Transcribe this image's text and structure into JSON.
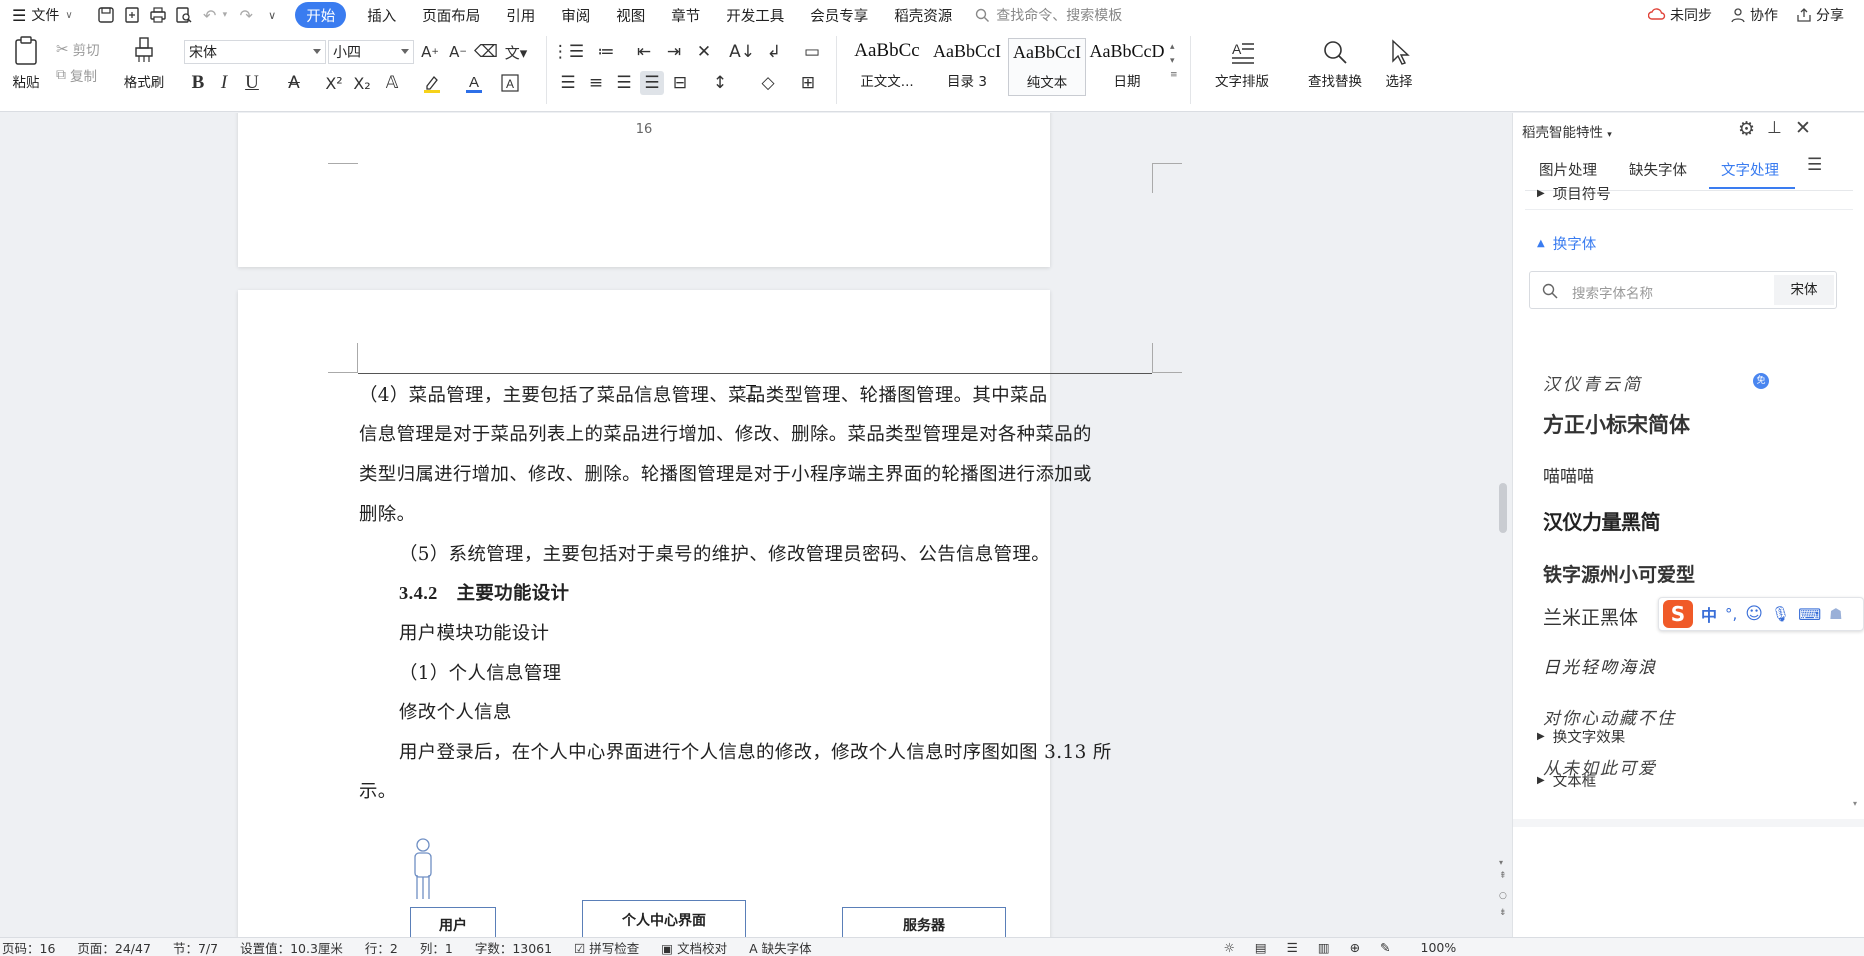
{
  "menubar": {
    "file_label": "文件",
    "tabs": [
      "开始",
      "插入",
      "页面布局",
      "引用",
      "审阅",
      "视图",
      "章节",
      "开发工具",
      "会员专享",
      "稻壳资源"
    ],
    "search_placeholder": "查找命令、搜索模板",
    "sync_label": "未同步",
    "collab_label": "协作",
    "share_label": "分享"
  },
  "ribbon": {
    "paste_label": "粘贴",
    "cut_label": "剪切",
    "copy_label": "复制",
    "format_painter_label": "格式刷",
    "font_name": "宋体",
    "font_size": "小四",
    "styles": [
      {
        "sample": "AaBbCc",
        "name": "正文文..."
      },
      {
        "sample": "AaBbCcI",
        "name": "目录 3"
      },
      {
        "sample": "AaBbCcI",
        "name": "纯文本"
      },
      {
        "sample": "AaBbCcD",
        "name": "日期"
      }
    ],
    "text_layout_label": "文字排版",
    "find_replace_label": "查找替换",
    "select_label": "选择"
  },
  "document": {
    "page_number": "16",
    "lines": [
      "（4）菜品管理，主要包括了菜品信息管理、菜品类型管理、轮播图管理。其中菜品",
      "信息管理是对于菜品列表上的菜品进行增加、修改、删除。菜品类型管理是对各种菜品的",
      "类型归属进行增加、修改、删除。轮播图管理是对于小程序端主界面的轮播图进行添加或",
      "删除。",
      "（5）系统管理，主要包括对于桌号的维护、修改管理员密码、公告信息管理。",
      "3.4.2　主要功能设计",
      "用户模块功能设计",
      "（1）个人信息管理",
      "修改个人信息",
      "用户登录后，在个人中心界面进行个人信息的修改，修改个人信息时序图如图 3.13 所",
      "示。"
    ],
    "diagram": {
      "actor_label": "用户",
      "box1_label": "个人中心界面",
      "box2_label": "服务器"
    }
  },
  "panel": {
    "title": "稻壳智能特性",
    "tabs": [
      "图片处理",
      "缺失字体",
      "文字处理"
    ],
    "sections": {
      "bullets": "项目符号",
      "change_font": "换字体",
      "font_effects": "换文字效果",
      "textbox": "文本框"
    },
    "search_placeholder": "搜索字体名称",
    "current_font": "宋体",
    "fonts": [
      "汉仪青云简",
      "方正小标宋简体",
      "喵喵喵",
      "汉仪力量黑简",
      "铁字源州小可爱型",
      "兰米正黑体",
      "日光轻吻海浪",
      "对你心动藏不住",
      "从未如此可爱"
    ],
    "free_badge": "免"
  },
  "ime": {
    "mode": "中"
  },
  "status": {
    "page_num": "页码：16",
    "page_of": "页面：24/47",
    "section": "节：7/7",
    "setting": "设置值：10.3厘米",
    "row": "行：2",
    "col": "列：1",
    "words": "字数：13061",
    "spell": "拼写检查",
    "proof": "文档校对",
    "missing_font": "缺失字体",
    "zoom": "100%"
  }
}
